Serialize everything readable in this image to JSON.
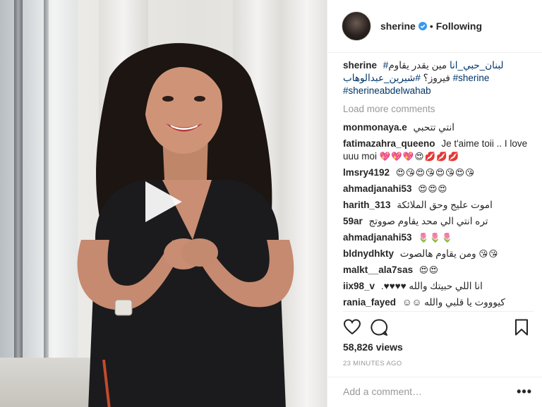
{
  "header": {
    "username": "sherine",
    "verified": true,
    "separator": "•",
    "follow_status": "Following"
  },
  "caption": {
    "username": "sherine",
    "text": "مين يقدر يقاوم فيروز؟",
    "hashtags": [
      "#لبنان_حبي_انا",
      "#شيرين_عبدالوهاب",
      "#sherine",
      "#sherineabdelwahab"
    ]
  },
  "load_more": "Load more comments",
  "comments": [
    {
      "username": "monmonaya.e",
      "text": "انتي تتحبي",
      "emoji": ""
    },
    {
      "username": "fatimazahra_queeno",
      "text": "Je t'aime toii .. I love uuu moi",
      "emoji": "💖💖💖😍💋💋💋"
    },
    {
      "username": "lmsry4192",
      "text": "",
      "emoji": "😍😘😍😘😍😘😍😘"
    },
    {
      "username": "ahmadjanahi53",
      "text": "",
      "emoji": "😍😍😍"
    },
    {
      "username": "harith_313",
      "text": "اموت عليج وحق الملائكة",
      "emoji": ""
    },
    {
      "username": "59ar",
      "text": "تره انتي الي محد يقاوم صووتج",
      "emoji": ""
    },
    {
      "username": "ahmadjanahi53",
      "text": "",
      "emoji": "🌷🌷🌷"
    },
    {
      "username": "bldnydhkty",
      "text": "ومن يقاوم هالصوت",
      "emoji": "😘😘"
    },
    {
      "username": "malkt__ala7sas",
      "text": "",
      "emoji": "😍😍"
    },
    {
      "username": "iix98_v",
      "text": "انا اللي حبيتك والله ♥♥♥♥.",
      "emoji": ""
    },
    {
      "username": "rania_fayed",
      "text": "كيوووت يا قلبي والله ☺☺",
      "emoji": ""
    }
  ],
  "views": "58,826 views",
  "timestamp": "23 MINUTES AGO",
  "add_comment_placeholder": "Add a comment…",
  "more_options": "•••",
  "icons": [
    "verified-icon",
    "heart-icon",
    "comment-icon",
    "bookmark-icon",
    "play-icon"
  ],
  "colors": {
    "link": "#003569",
    "muted": "#999999",
    "verified": "#3897f0",
    "text": "#262626"
  }
}
